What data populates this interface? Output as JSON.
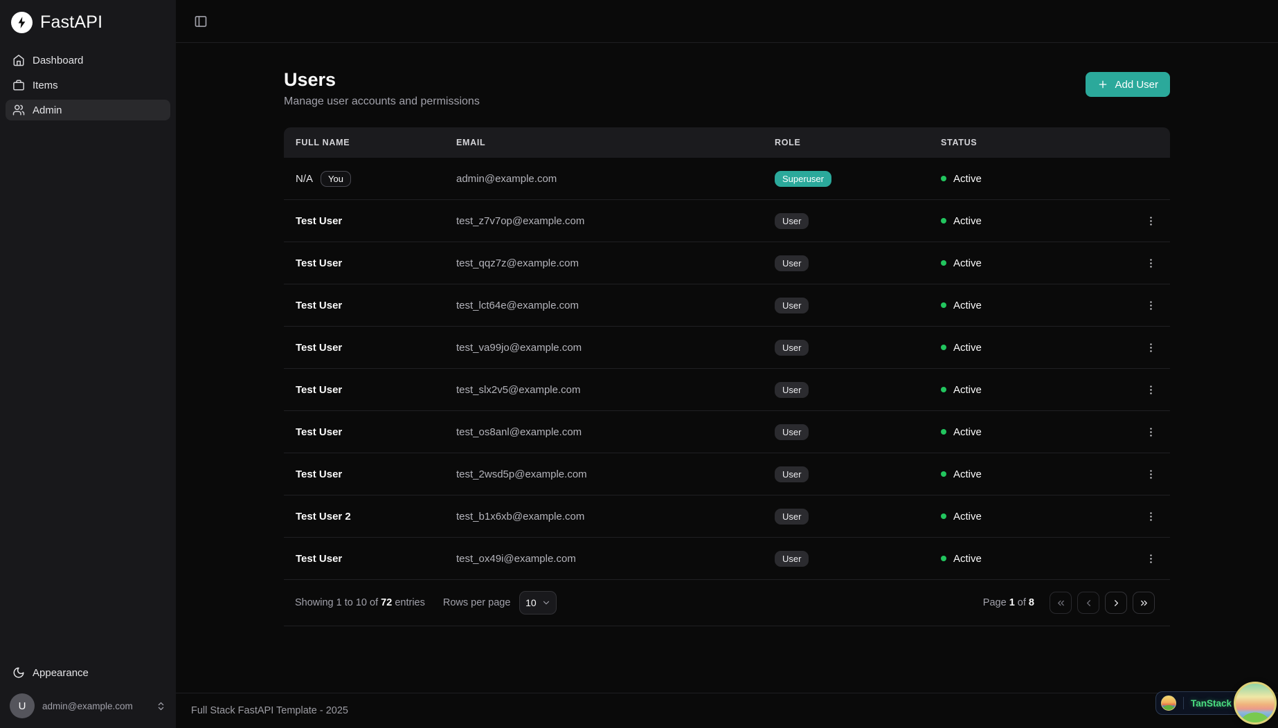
{
  "sidebar": {
    "logo": {
      "text": "FastAPI",
      "icon": "fastapi-bolt-icon"
    },
    "nav": [
      {
        "label": "Dashboard",
        "icon": "home-icon",
        "active": false
      },
      {
        "label": "Items",
        "icon": "briefcase-icon",
        "active": false
      },
      {
        "label": "Admin",
        "icon": "users-icon",
        "active": true
      }
    ],
    "appearance": {
      "label": "Appearance",
      "icon": "moon-icon"
    },
    "user": {
      "initial": "U",
      "email": "admin@example.com",
      "chevron_icon": "chevrons-up-down-icon"
    }
  },
  "topbar": {
    "toggle_icon": "panel-left-icon"
  },
  "page": {
    "title": "Users",
    "subtitle": "Manage user accounts and permissions",
    "add_user_button": "Add User"
  },
  "table": {
    "columns": [
      "Full Name",
      "Email",
      "Role",
      "Status"
    ],
    "rows": [
      {
        "name": "N/A",
        "badge": "You",
        "email": "admin@example.com",
        "role": "Superuser",
        "role_variant": "superuser",
        "status": "Active",
        "has_actions": false
      },
      {
        "name": "Test User",
        "email": "test_z7v7op@example.com",
        "role": "User",
        "role_variant": "user",
        "status": "Active",
        "has_actions": true
      },
      {
        "name": "Test User",
        "email": "test_qqz7z@example.com",
        "role": "User",
        "role_variant": "user",
        "status": "Active",
        "has_actions": true
      },
      {
        "name": "Test User",
        "email": "test_lct64e@example.com",
        "role": "User",
        "role_variant": "user",
        "status": "Active",
        "has_actions": true
      },
      {
        "name": "Test User",
        "email": "test_va99jo@example.com",
        "role": "User",
        "role_variant": "user",
        "status": "Active",
        "has_actions": true
      },
      {
        "name": "Test User",
        "email": "test_slx2v5@example.com",
        "role": "User",
        "role_variant": "user",
        "status": "Active",
        "has_actions": true
      },
      {
        "name": "Test User",
        "email": "test_os8anl@example.com",
        "role": "User",
        "role_variant": "user",
        "status": "Active",
        "has_actions": true
      },
      {
        "name": "Test User",
        "email": "test_2wsd5p@example.com",
        "role": "User",
        "role_variant": "user",
        "status": "Active",
        "has_actions": true
      },
      {
        "name": "Test User 2",
        "email": "test_b1x6xb@example.com",
        "role": "User",
        "role_variant": "user",
        "status": "Active",
        "has_actions": true
      },
      {
        "name": "Test User",
        "email": "test_ox49i@example.com",
        "role": "User",
        "role_variant": "user",
        "status": "Active",
        "has_actions": true
      }
    ]
  },
  "pagination": {
    "showing_prefix": "Showing 1 to 10 of",
    "total_entries": "72",
    "showing_suffix": "entries",
    "rows_per_page_label": "Rows per page",
    "rows_per_page_value": "10",
    "page_label": "Page",
    "current_page": "1",
    "of_label": "of",
    "total_pages": "8",
    "buttons": [
      {
        "icon": "chevrons-left-icon",
        "disabled": true
      },
      {
        "icon": "chevron-left-icon",
        "disabled": true
      },
      {
        "icon": "chevron-right-icon",
        "disabled": false
      },
      {
        "icon": "chevrons-right-icon",
        "disabled": false
      }
    ]
  },
  "footer": {
    "text": "Full Stack FastAPI Template - 2025"
  },
  "devtools": {
    "label": "TanStack",
    "icon": "tanstack-island-icon"
  },
  "colors": {
    "accent_teal": "#2ba99b",
    "status_active_green": "#22c55e",
    "sidebar_bg": "#18181b",
    "main_bg": "#0a0a0a",
    "table_header_bg": "#1b1b1e",
    "devtools_green": "#4ade80"
  }
}
